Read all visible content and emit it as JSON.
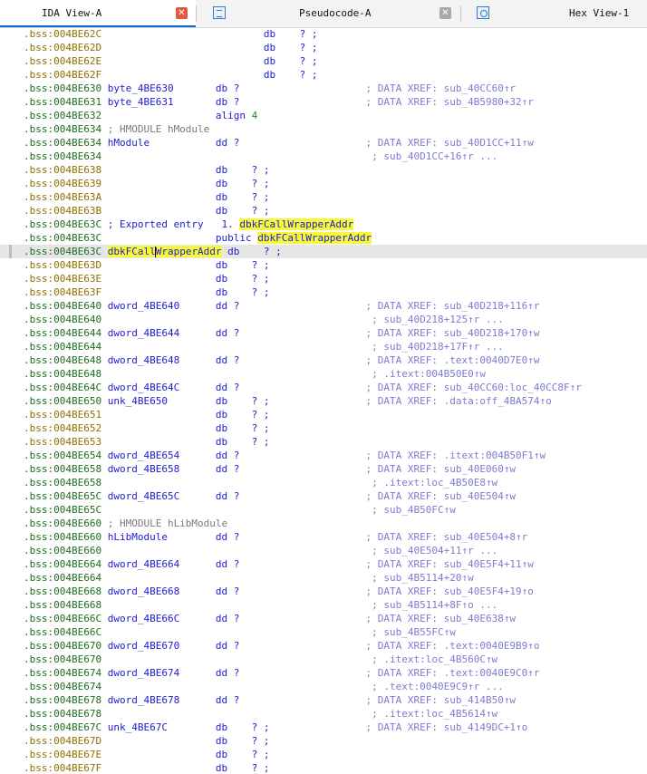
{
  "tabs": [
    {
      "label": "IDA View-A",
      "active": true,
      "icon": "close-icon"
    },
    {
      "label": "Pseudocode-A",
      "active": false,
      "icon": "pseudocode-icon"
    },
    {
      "label": "Hex View-1",
      "active": false,
      "icon": "hex-view-icon"
    }
  ],
  "colors": {
    "address_green": "#1f6c1f",
    "address_uninit": "#8f6f00",
    "code_blue": "#1c1ccf",
    "comment_gray": "#7a7a7a",
    "xref": "#7c7cd0",
    "highlight": "#f8f83a",
    "selected_line": "#e6e6e6"
  },
  "highlight_word": "dbkFCallWrapperAddr",
  "lines": [
    {
      "addr": ".bss:004BE62C",
      "code": "                           db    ? ;",
      "uninit": true
    },
    {
      "addr": ".bss:004BE62D",
      "code": "                           db    ? ;",
      "uninit": true
    },
    {
      "addr": ".bss:004BE62E",
      "code": "                           db    ? ;",
      "uninit": true
    },
    {
      "addr": ".bss:004BE62F",
      "code": "                           db    ? ;",
      "uninit": true
    },
    {
      "addr": ".bss:004BE630",
      "code": " byte_4BE630       db ?",
      "comment": "                     ; DATA XREF: sub_40CC60↑r"
    },
    {
      "addr": ".bss:004BE631",
      "code": " byte_4BE631       db ?",
      "comment": "                     ; DATA XREF: sub_4B5980+32↑r"
    },
    {
      "addr": ".bss:004BE632",
      "code": "                   align ",
      "imm": "4"
    },
    {
      "addr": ".bss:004BE634",
      "comment": " ; HMODULE hModule",
      "plain_comment": true
    },
    {
      "addr": ".bss:004BE634",
      "code": " hModule           dd ?",
      "comment": "                     ; DATA XREF: sub_40D1CC+11↑w"
    },
    {
      "addr": ".bss:004BE634",
      "comment": "                                             ; sub_40D1CC+16↑r ..."
    },
    {
      "addr": ".bss:004BE638",
      "code": "                   db    ? ;",
      "uninit": true
    },
    {
      "addr": ".bss:004BE639",
      "code": "                   db    ? ;",
      "uninit": true
    },
    {
      "addr": ".bss:004BE63A",
      "code": "                   db    ? ;",
      "uninit": true
    },
    {
      "addr": ".bss:004BE63B",
      "code": "                   db    ? ;",
      "uninit": true
    },
    {
      "addr": ".bss:004BE63C",
      "code": " ; Exported entry   1. ",
      "hl": "dbkFCallWrapperAddr"
    },
    {
      "addr": ".bss:004BE63C",
      "code": "                   public ",
      "hl": "dbkFCallWrapperAddr"
    },
    {
      "addr": ".bss:004BE63C",
      "code": " ",
      "hl": "dbkFCallWrapperAddr",
      "after": " db    ? ;",
      "selected": true
    },
    {
      "addr": ".bss:004BE63D",
      "code": "                   db    ? ;",
      "uninit": true
    },
    {
      "addr": ".bss:004BE63E",
      "code": "                   db    ? ;",
      "uninit": true
    },
    {
      "addr": ".bss:004BE63F",
      "code": "                   db    ? ;",
      "uninit": true
    },
    {
      "addr": ".bss:004BE640",
      "code": " dword_4BE640      dd ?",
      "comment": "                     ; DATA XREF: sub_40D218+116↑r"
    },
    {
      "addr": ".bss:004BE640",
      "comment": "                                             ; sub_40D218+125↑r ..."
    },
    {
      "addr": ".bss:004BE644",
      "code": " dword_4BE644      dd ?",
      "comment": "                     ; DATA XREF: sub_40D218+170↑w"
    },
    {
      "addr": ".bss:004BE644",
      "comment": "                                             ; sub_40D218+17F↑r ..."
    },
    {
      "addr": ".bss:004BE648",
      "code": " dword_4BE648      dd ?",
      "comment": "                     ; DATA XREF: .text:0040D7E0↑w"
    },
    {
      "addr": ".bss:004BE648",
      "comment": "                                             ; .itext:004B50E0↑w"
    },
    {
      "addr": ".bss:004BE64C",
      "code": " dword_4BE64C      dd ?",
      "comment": "                     ; DATA XREF: sub_40CC60:loc_40CC8F↑r"
    },
    {
      "addr": ".bss:004BE650",
      "code": " unk_4BE650        db    ? ;",
      "comment": "                ; DATA XREF: .data:off_4BA574↑o"
    },
    {
      "addr": ".bss:004BE651",
      "code": "                   db    ? ;",
      "uninit": true
    },
    {
      "addr": ".bss:004BE652",
      "code": "                   db    ? ;",
      "uninit": true
    },
    {
      "addr": ".bss:004BE653",
      "code": "                   db    ? ;",
      "uninit": true
    },
    {
      "addr": ".bss:004BE654",
      "code": " dword_4BE654      dd ?",
      "comment": "                     ; DATA XREF: .itext:004B50F1↑w"
    },
    {
      "addr": ".bss:004BE658",
      "code": " dword_4BE658      dd ?",
      "comment": "                     ; DATA XREF: sub_40E060↑w"
    },
    {
      "addr": ".bss:004BE658",
      "comment": "                                             ; .itext:loc_4B50E8↑w"
    },
    {
      "addr": ".bss:004BE65C",
      "code": " dword_4BE65C      dd ?",
      "comment": "                     ; DATA XREF: sub_40E504↑w"
    },
    {
      "addr": ".bss:004BE65C",
      "comment": "                                             ; sub_4B50FC↑w"
    },
    {
      "addr": ".bss:004BE660",
      "comment": " ; HMODULE hLibModule",
      "plain_comment": true
    },
    {
      "addr": ".bss:004BE660",
      "code": " hLibModule        dd ?",
      "comment": "                     ; DATA XREF: sub_40E504+8↑r"
    },
    {
      "addr": ".bss:004BE660",
      "comment": "                                             ; sub_40E504+11↑r ..."
    },
    {
      "addr": ".bss:004BE664",
      "code": " dword_4BE664      dd ?",
      "comment": "                     ; DATA XREF: sub_40E5F4+11↑w"
    },
    {
      "addr": ".bss:004BE664",
      "comment": "                                             ; sub_4B5114+20↑w"
    },
    {
      "addr": ".bss:004BE668",
      "code": " dword_4BE668      dd ?",
      "comment": "                     ; DATA XREF: sub_40E5F4+19↑o"
    },
    {
      "addr": ".bss:004BE668",
      "comment": "                                             ; sub_4B5114+8F↑o ..."
    },
    {
      "addr": ".bss:004BE66C",
      "code": " dword_4BE66C      dd ?",
      "comment": "                     ; DATA XREF: sub_40E638↑w"
    },
    {
      "addr": ".bss:004BE66C",
      "comment": "                                             ; sub_4B55FC↑w"
    },
    {
      "addr": ".bss:004BE670",
      "code": " dword_4BE670      dd ?",
      "comment": "                     ; DATA XREF: .text:0040E9B9↑o"
    },
    {
      "addr": ".bss:004BE670",
      "comment": "                                             ; .itext:loc_4B560C↑w"
    },
    {
      "addr": ".bss:004BE674",
      "code": " dword_4BE674      dd ?",
      "comment": "                     ; DATA XREF: .text:0040E9C0↑r"
    },
    {
      "addr": ".bss:004BE674",
      "comment": "                                             ; .text:0040E9C9↑r ..."
    },
    {
      "addr": ".bss:004BE678",
      "code": " dword_4BE678      dd ?",
      "comment": "                     ; DATA XREF: sub_414B50↑w"
    },
    {
      "addr": ".bss:004BE678",
      "comment": "                                             ; .itext:loc_4B5614↑w"
    },
    {
      "addr": ".bss:004BE67C",
      "code": " unk_4BE67C        db    ? ;",
      "comment": "                ; DATA XREF: sub_4149DC+1↑o"
    },
    {
      "addr": ".bss:004BE67D",
      "code": "                   db    ? ;",
      "uninit": true
    },
    {
      "addr": ".bss:004BE67E",
      "code": "                   db    ? ;",
      "uninit": true
    },
    {
      "addr": ".bss:004BE67F",
      "code": "                   db    ? ;",
      "uninit": true
    }
  ]
}
